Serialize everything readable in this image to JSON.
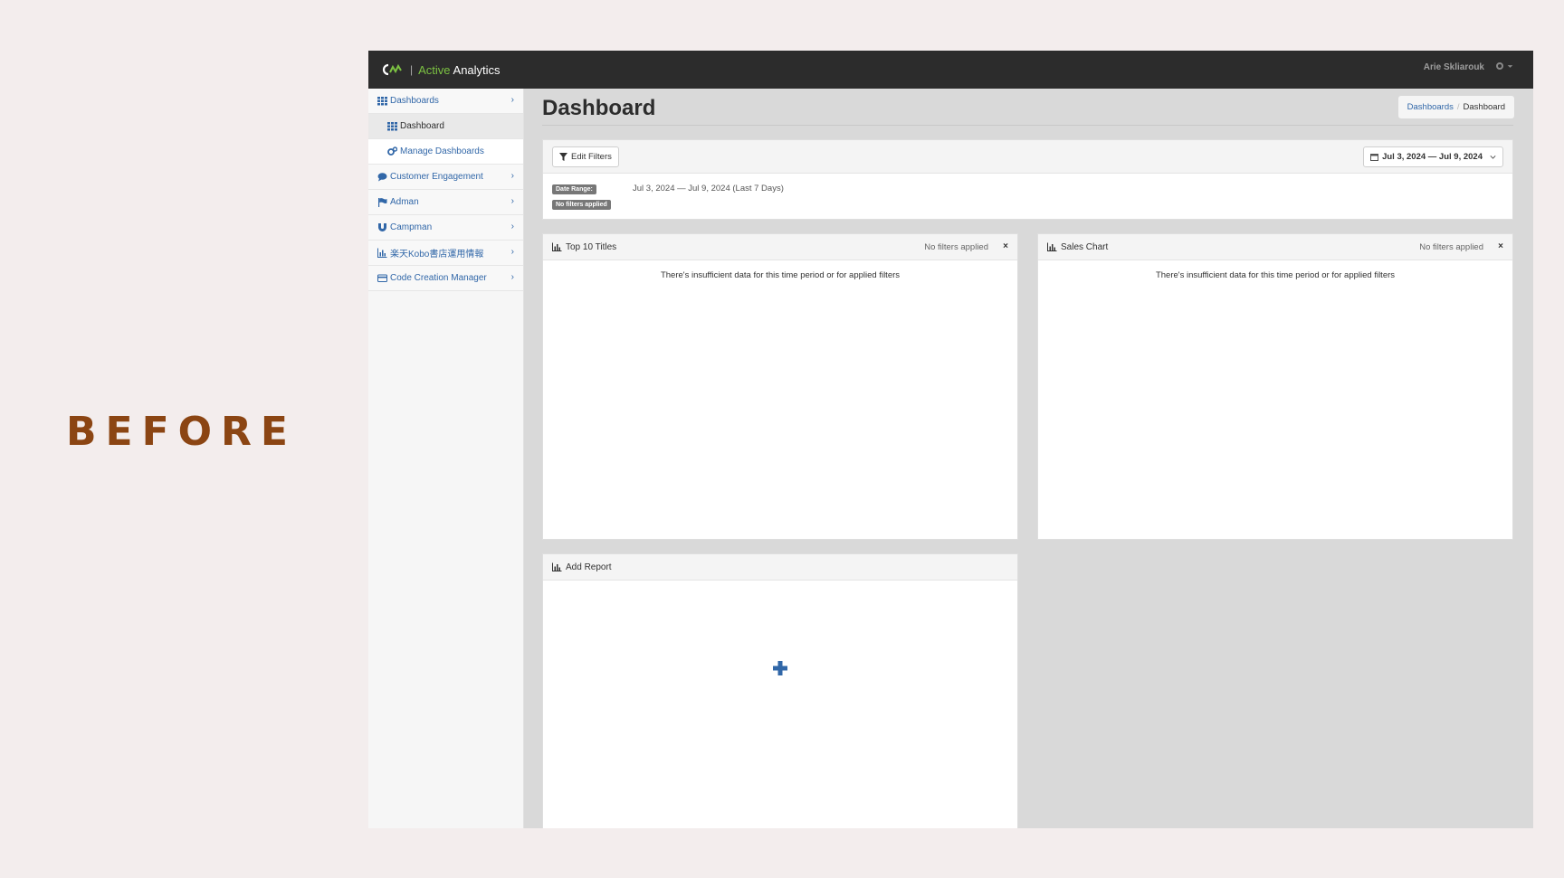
{
  "slide_label": "BEFORE",
  "header": {
    "brand_sep": "|",
    "brand_active": "Active",
    "brand_analytics": "Analytics",
    "user_name": "Arie Skliarouk",
    "accent_color": "#7cc242"
  },
  "sidebar": {
    "items": [
      {
        "label": "Dashboards",
        "icon": "grid-icon"
      },
      {
        "label": "Dashboard",
        "icon": "grid-icon"
      },
      {
        "label": "Manage Dashboards",
        "icon": "cogs-icon"
      },
      {
        "label": "Customer Engagement",
        "icon": "comment-icon"
      },
      {
        "label": "Adman",
        "icon": "flag-icon"
      },
      {
        "label": "Campman",
        "icon": "magnet-icon"
      },
      {
        "label": "楽天Kobo書店運用情報",
        "icon": "bar-chart-icon"
      },
      {
        "label": "Code Creation Manager",
        "icon": "credit-card-icon"
      }
    ],
    "chevron": "›"
  },
  "main": {
    "title": "Dashboard",
    "breadcrumb": {
      "link": "Dashboards",
      "sep": "/",
      "current": "Dashboard"
    },
    "filters": {
      "edit_label": "Edit Filters",
      "date_button": "Jul 3, 2024 — Jul 9, 2024",
      "date_range_badge": "Date Range:",
      "no_filters_badge": "No filters applied",
      "date_value": "Jul 3, 2024 — Jul 9, 2024 (Last 7 Days)"
    },
    "cards": [
      {
        "title": "Top 10 Titles",
        "status": "No filters applied",
        "close": "×",
        "message": "There's insufficient data for this time period or for applied filters"
      },
      {
        "title": "Sales Chart",
        "status": "No filters applied",
        "close": "×",
        "message": "There's insufficient data for this time period or for applied filters"
      },
      {
        "title": "Add Report"
      }
    ]
  }
}
